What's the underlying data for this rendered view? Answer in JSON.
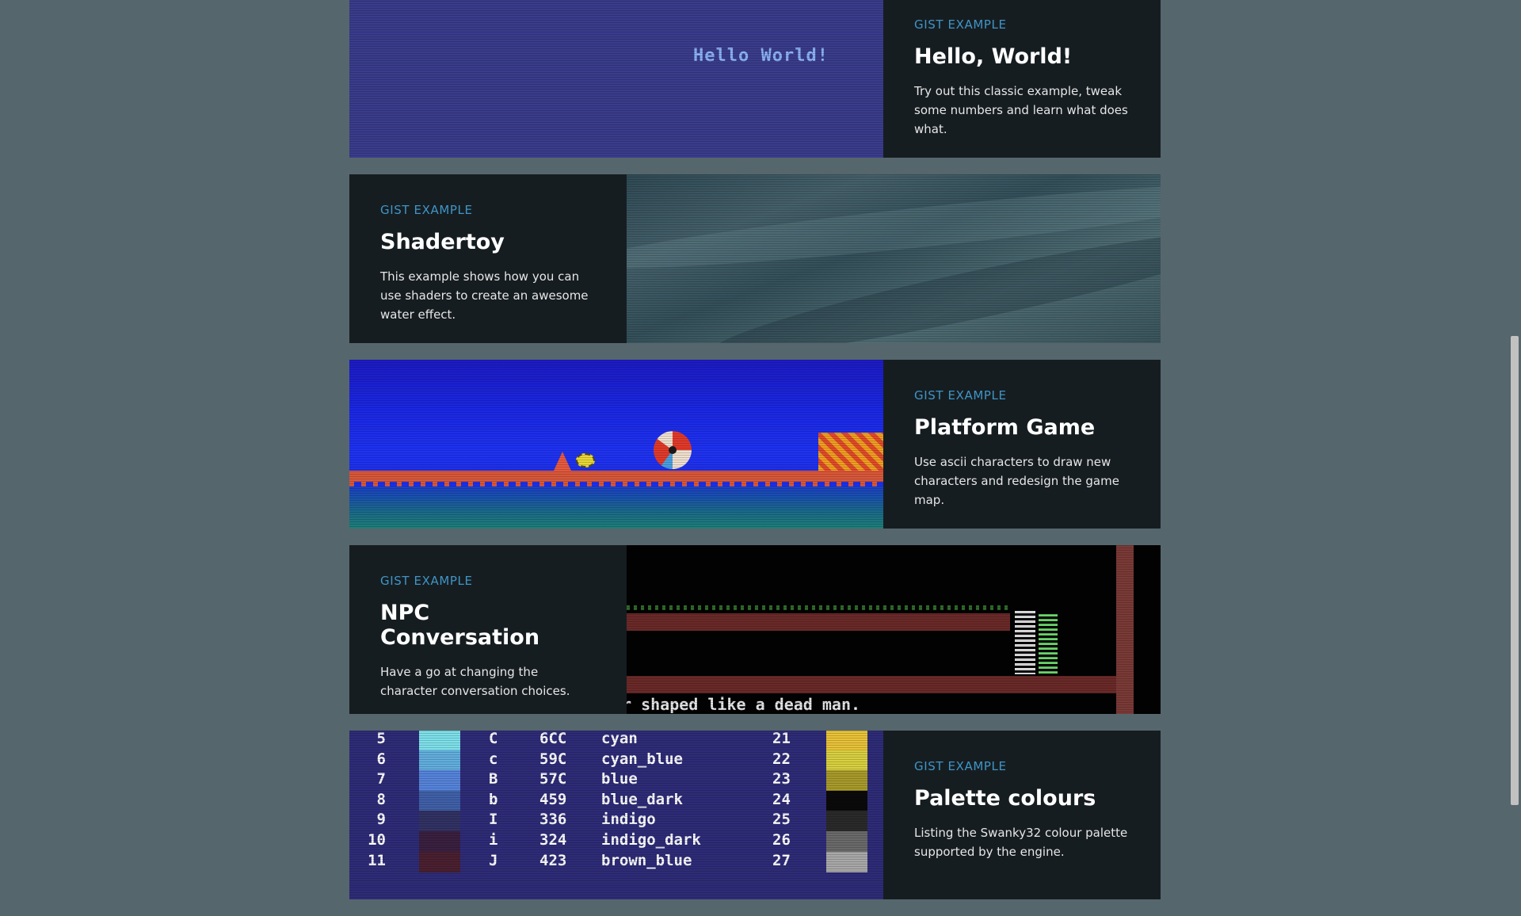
{
  "cards": [
    {
      "eyebrow": "GIST EXAMPLE",
      "title": "Hello, World!",
      "description": "Try out this classic example, tweak some numbers and learn what does what.",
      "screen_text": "Hello World!"
    },
    {
      "eyebrow": "GIST EXAMPLE",
      "title": "Shadertoy",
      "description": "This example shows how you can use shaders to create an awesome water effect."
    },
    {
      "eyebrow": "GIST EXAMPLE",
      "title": "Platform Game",
      "description": "Use ascii characters to draw new characters and redesign the game map."
    },
    {
      "eyebrow": "GIST EXAMPLE",
      "title": "NPC Conversation",
      "description": "Have a go at changing the character conversation choices.",
      "screen_text": "r shaped like a dead man."
    },
    {
      "eyebrow": "GIST EXAMPLE",
      "title": "Palette colours",
      "description": "Listing the Swanky32 colour palette supported by the engine."
    }
  ],
  "palette_rows": [
    {
      "num": "5",
      "chr": "C",
      "hex": "6CC",
      "name": "cyan",
      "idx": "21",
      "left_color": "#7ee0ea",
      "right_color": "#e8c238"
    },
    {
      "num": "6",
      "chr": "c",
      "hex": "59C",
      "name": "cyan_blue",
      "idx": "22",
      "left_color": "#62aede",
      "right_color": "#d8d040"
    },
    {
      "num": "7",
      "chr": "B",
      "hex": "57C",
      "name": "blue",
      "idx": "23",
      "left_color": "#5684da",
      "right_color": "#a89a2a"
    },
    {
      "num": "8",
      "chr": "b",
      "hex": "459",
      "name": "blue_dark",
      "idx": "24",
      "left_color": "#4060a8",
      "right_color": "#0a0a0a"
    },
    {
      "num": "9",
      "chr": "I",
      "hex": "336",
      "name": "indigo",
      "idx": "25",
      "left_color": "#323264",
      "right_color": "#2a2a2a"
    },
    {
      "num": "10",
      "chr": "i",
      "hex": "324",
      "name": "indigo_dark",
      "idx": "26",
      "left_color": "#3a2040",
      "right_color": "#6a6a6a"
    },
    {
      "num": "11",
      "chr": "J",
      "hex": "423",
      "name": "brown_blue",
      "idx": "27",
      "left_color": "#4a2030",
      "right_color": "#a8a8a8"
    }
  ]
}
